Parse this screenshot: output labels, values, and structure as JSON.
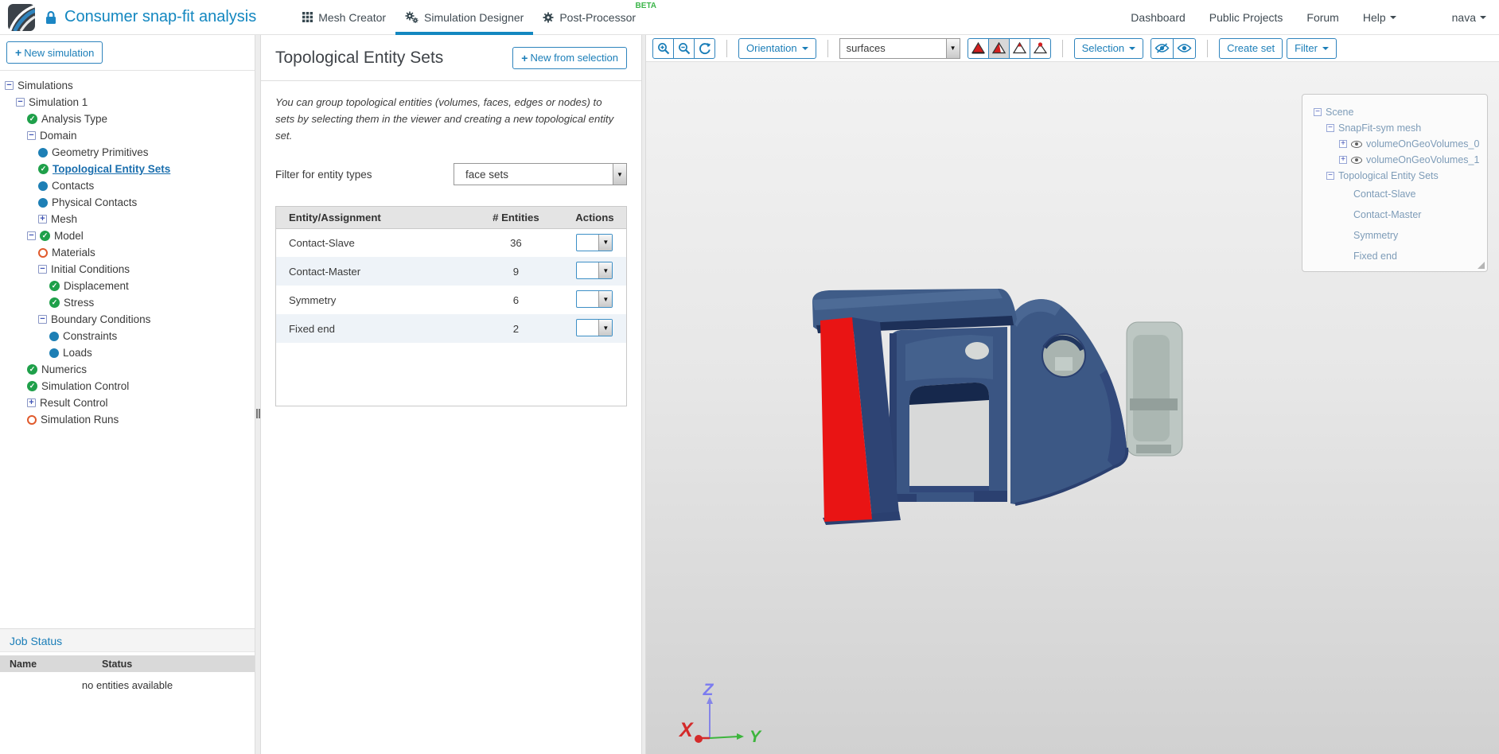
{
  "header": {
    "title": "Consumer snap-fit analysis",
    "tabs": [
      {
        "label": "Mesh Creator",
        "active": false
      },
      {
        "label": "Simulation Designer",
        "active": true
      },
      {
        "label": "Post-Processor",
        "active": false,
        "badge": "BETA"
      }
    ],
    "nav": [
      "Dashboard",
      "Public Projects",
      "Forum"
    ],
    "help": "Help",
    "user": "nava"
  },
  "sidebar": {
    "new_simulation": "New simulation",
    "tree": [
      {
        "label": "Simulations",
        "level": 0,
        "expander": "minus",
        "status": "none"
      },
      {
        "label": "Simulation 1",
        "level": 1,
        "expander": "minus",
        "status": "none"
      },
      {
        "label": "Analysis Type",
        "level": 2,
        "expander": "none",
        "status": "check"
      },
      {
        "label": "Domain",
        "level": 2,
        "expander": "minus",
        "status": "none"
      },
      {
        "label": "Geometry Primitives",
        "level": 3,
        "expander": "none",
        "status": "dot"
      },
      {
        "label": "Topological Entity Sets",
        "level": 3,
        "expander": "none",
        "status": "check",
        "selected": true
      },
      {
        "label": "Contacts",
        "level": 3,
        "expander": "none",
        "status": "dot"
      },
      {
        "label": "Physical Contacts",
        "level": 3,
        "expander": "none",
        "status": "dot"
      },
      {
        "label": "Mesh",
        "level": 3,
        "expander": "plus",
        "status": "none"
      },
      {
        "label": "Model",
        "level": 2,
        "expander": "minus",
        "status": "check"
      },
      {
        "label": "Materials",
        "level": 3,
        "expander": "none",
        "status": "ring"
      },
      {
        "label": "Initial Conditions",
        "level": 3,
        "expander": "minus",
        "status": "none"
      },
      {
        "label": "Displacement",
        "level": 4,
        "expander": "none",
        "status": "check"
      },
      {
        "label": "Stress",
        "level": 4,
        "expander": "none",
        "status": "check"
      },
      {
        "label": "Boundary Conditions",
        "level": 3,
        "expander": "minus",
        "status": "none"
      },
      {
        "label": "Constraints",
        "level": 4,
        "expander": "none",
        "status": "dot"
      },
      {
        "label": "Loads",
        "level": 4,
        "expander": "none",
        "status": "dot"
      },
      {
        "label": "Numerics",
        "level": 2,
        "expander": "none",
        "status": "check"
      },
      {
        "label": "Simulation Control",
        "level": 2,
        "expander": "none",
        "status": "check"
      },
      {
        "label": "Result Control",
        "level": 2,
        "expander": "plus",
        "status": "none"
      },
      {
        "label": "Simulation Runs",
        "level": 2,
        "expander": "none",
        "status": "ring"
      }
    ],
    "job_status": {
      "title": "Job Status",
      "columns": [
        "Name",
        "Status"
      ],
      "empty": "no entities available"
    }
  },
  "panel": {
    "title": "Topological Entity Sets",
    "new_from_selection": "New from selection",
    "description": "You can group topological entities (volumes, faces, edges or nodes) to sets by selecting them in the viewer and creating a new topological entity set.",
    "filter_label": "Filter for entity types",
    "filter_value": "face sets",
    "table": {
      "columns": [
        "Entity/Assignment",
        "# Entities",
        "Actions"
      ],
      "rows": [
        {
          "name": "Contact-Slave",
          "entities": "36"
        },
        {
          "name": "Contact-Master",
          "entities": "9"
        },
        {
          "name": "Symmetry",
          "entities": "6"
        },
        {
          "name": "Fixed end",
          "entities": "2"
        }
      ]
    }
  },
  "viewer": {
    "toolbar": {
      "orientation": "Orientation",
      "display_mode": "surfaces",
      "selection": "Selection",
      "create_set": "Create set",
      "filter": "Filter",
      "mesh_modes": [
        "mesh-solid",
        "mesh-surface-edges",
        "mesh-wireframe",
        "mesh-points"
      ],
      "active_mesh_mode": "mesh-surface-edges"
    },
    "scene_tree": [
      {
        "label": "Scene",
        "level": 0,
        "expander": "minus",
        "eye": false,
        "leaf": false
      },
      {
        "label": "SnapFit-sym mesh",
        "level": 1,
        "expander": "minus",
        "eye": false,
        "leaf": false
      },
      {
        "label": "volumeOnGeoVolumes_0",
        "level": 2,
        "expander": "plus",
        "eye": true,
        "leaf": false
      },
      {
        "label": "volumeOnGeoVolumes_1",
        "level": 2,
        "expander": "plus",
        "eye": true,
        "leaf": false
      },
      {
        "label": "Topological Entity Sets",
        "level": 1,
        "expander": "minus",
        "eye": false,
        "leaf": false
      },
      {
        "label": "Contact-Slave",
        "level": 2,
        "expander": "none",
        "eye": false,
        "leaf": true
      },
      {
        "label": "Contact-Master",
        "level": 2,
        "expander": "none",
        "eye": false,
        "leaf": true
      },
      {
        "label": "Symmetry",
        "level": 2,
        "expander": "none",
        "eye": false,
        "leaf": true
      },
      {
        "label": "Fixed end",
        "level": 2,
        "expander": "none",
        "eye": false,
        "leaf": true
      }
    ],
    "axis": {
      "x": "X",
      "y": "Y",
      "z": "Z"
    }
  },
  "colors": {
    "accent_blue": "#1b7eb8",
    "title_blue": "#1387c0",
    "beta_green": "#3cb54a",
    "check_green": "#1fa04a",
    "dot_blue": "#1d7fb5",
    "ring_orange": "#e05a2c",
    "model_blue": "#3c5885",
    "model_blue_dark": "#2e4474",
    "model_red": "#e91414",
    "model_gray": "#bdc7c3",
    "axis_x_red": "#d42a2a",
    "axis_y_green": "#3db53d",
    "axis_z_blue": "#7b7bf0"
  }
}
